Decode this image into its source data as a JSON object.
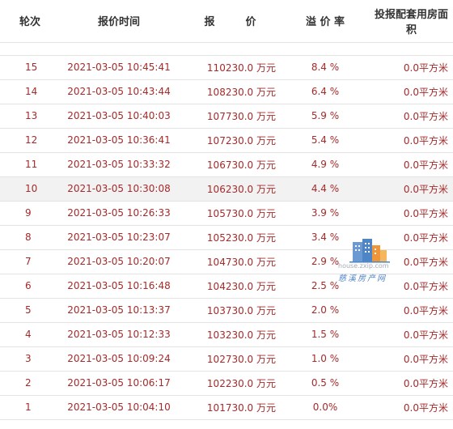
{
  "header": {
    "round": "轮次",
    "time": "报价时间",
    "price_left": "报",
    "price_right": "价",
    "premium": "溢 价 率",
    "area": "投报配套用房面积"
  },
  "rows": [
    {
      "round": "15",
      "time": "2021-03-05 10:45:41",
      "price": "110230.0 万元",
      "premium": "8.4 %",
      "area": "0.0平方米"
    },
    {
      "round": "14",
      "time": "2021-03-05 10:43:44",
      "price": "108230.0 万元",
      "premium": "6.4 %",
      "area": "0.0平方米"
    },
    {
      "round": "13",
      "time": "2021-03-05 10:40:03",
      "price": "107730.0 万元",
      "premium": "5.9 %",
      "area": "0.0平方米"
    },
    {
      "round": "12",
      "time": "2021-03-05 10:36:41",
      "price": "107230.0 万元",
      "premium": "5.4 %",
      "area": "0.0平方米"
    },
    {
      "round": "11",
      "time": "2021-03-05 10:33:32",
      "price": "106730.0 万元",
      "premium": "4.9 %",
      "area": "0.0平方米"
    },
    {
      "round": "10",
      "time": "2021-03-05 10:30:08",
      "price": "106230.0 万元",
      "premium": "4.4 %",
      "area": "0.0平方米"
    },
    {
      "round": "9",
      "time": "2021-03-05 10:26:33",
      "price": "105730.0 万元",
      "premium": "3.9 %",
      "area": "0.0平方米"
    },
    {
      "round": "8",
      "time": "2021-03-05 10:23:07",
      "price": "105230.0 万元",
      "premium": "3.4 %",
      "area": "0.0平方米"
    },
    {
      "round": "7",
      "time": "2021-03-05 10:20:07",
      "price": "104730.0 万元",
      "premium": "2.9 %",
      "area": "0.0平方米"
    },
    {
      "round": "6",
      "time": "2021-03-05 10:16:48",
      "price": "104230.0 万元",
      "premium": "2.5 %",
      "area": "0.0平方米"
    },
    {
      "round": "5",
      "time": "2021-03-05 10:13:37",
      "price": "103730.0 万元",
      "premium": "2.0 %",
      "area": "0.0平方米"
    },
    {
      "round": "4",
      "time": "2021-03-05 10:12:33",
      "price": "103230.0 万元",
      "premium": "1.5 %",
      "area": "0.0平方米"
    },
    {
      "round": "3",
      "time": "2021-03-05 10:09:24",
      "price": "102730.0 万元",
      "premium": "1.0 %",
      "area": "0.0平方米"
    },
    {
      "round": "2",
      "time": "2021-03-05 10:06:17",
      "price": "102230.0 万元",
      "premium": "0.5 %",
      "area": "0.0平方米"
    },
    {
      "round": "1",
      "time": "2021-03-05 10:04:10",
      "price": "101730.0 万元",
      "premium": "0.0%",
      "area": "0.0平方米"
    }
  ],
  "highlighted_round": "10",
  "watermark": {
    "url": "house.zxip.com",
    "name": "慈溪房产网",
    "icon": "building-logo-icon"
  },
  "colors": {
    "row_text": "#a52a2a",
    "header_text": "#333333",
    "highlight_bg": "#f2f2f2",
    "divider": "#e3e3e3"
  }
}
